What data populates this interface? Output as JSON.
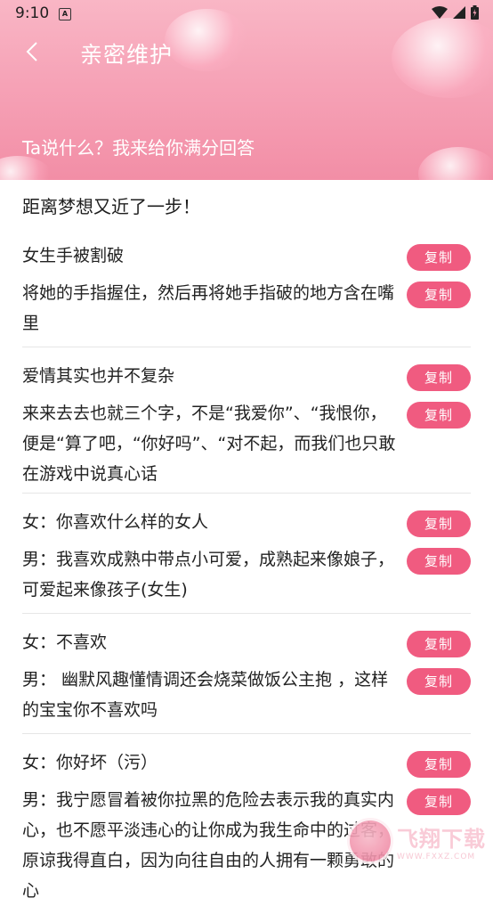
{
  "status_bar": {
    "time": "9:10",
    "notification_icon": "A"
  },
  "header": {
    "title": "亲密维护",
    "subtitle": "Ta说什么？我来给你满分回答"
  },
  "intro_text": "距离梦想又近了一步！",
  "copy_label": "复制",
  "cards": [
    {
      "question": "女生手被割破",
      "answer": "将她的手指握住，然后再将她手指破的地方含在嘴里"
    },
    {
      "question": "爱情其实也并不复杂",
      "answer": "来来去去也就三个字，不是“我爱你”、“我恨你，便是“算了吧，“你好吗”、“对不起，而我们也只敢在游戏中说真心话"
    },
    {
      "question": "女：你喜欢什么样的女人",
      "answer": "男：我喜欢成熟中带点小可爱，成熟起来像娘子，可爱起来像孩子(女生)"
    },
    {
      "question": "女：不喜欢",
      "answer": "男： 幽默风趣懂情调还会烧菜做饭公主抱 ，这样的宝宝你不喜欢吗"
    },
    {
      "question": "女：你好坏（污）",
      "answer": "男：我宁愿冒着被你拉黑的危险去表示我的真实内心，也不愿平淡违心的让你成为我生命中的过客，原谅我得直白，因为向往自由的人拥有一颗勇敢的心"
    }
  ],
  "watermark": {
    "text": "飞翔下载",
    "url": "WWW.FXXZ.COM"
  },
  "colors": {
    "accent": "#f05b80",
    "header_top": "#f9b6c5",
    "header_bottom": "#f28ea6"
  }
}
